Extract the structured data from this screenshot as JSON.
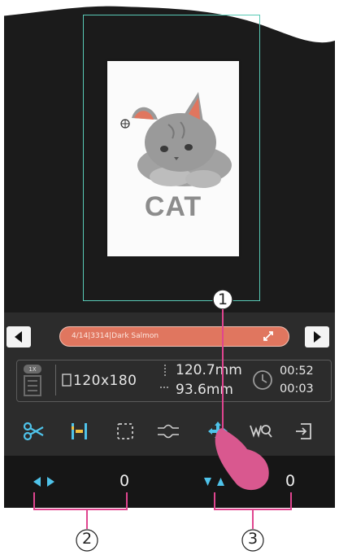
{
  "design": {
    "label": "CAT"
  },
  "color_bar": {
    "text": "4/14|3314|Dark Salmon"
  },
  "info": {
    "size": "120x180",
    "width": "120.7mm",
    "height": "93.6mm",
    "time_total": "00:52",
    "time_current": "00:03"
  },
  "position": {
    "x_value": "0",
    "y_value": "0"
  },
  "callouts": {
    "one": "1",
    "two": "2",
    "three": "3"
  },
  "colors": {
    "accent": "#4fc3ea",
    "thread": "#e0765f",
    "hoop": "#58c9b5",
    "callout_line": "#e0458f"
  },
  "toolbar_icons": [
    "scissors-icon",
    "align-icon",
    "select-area-icon",
    "jump-stitch-icon",
    "move-icon",
    "search-icon",
    "exit-icon"
  ]
}
